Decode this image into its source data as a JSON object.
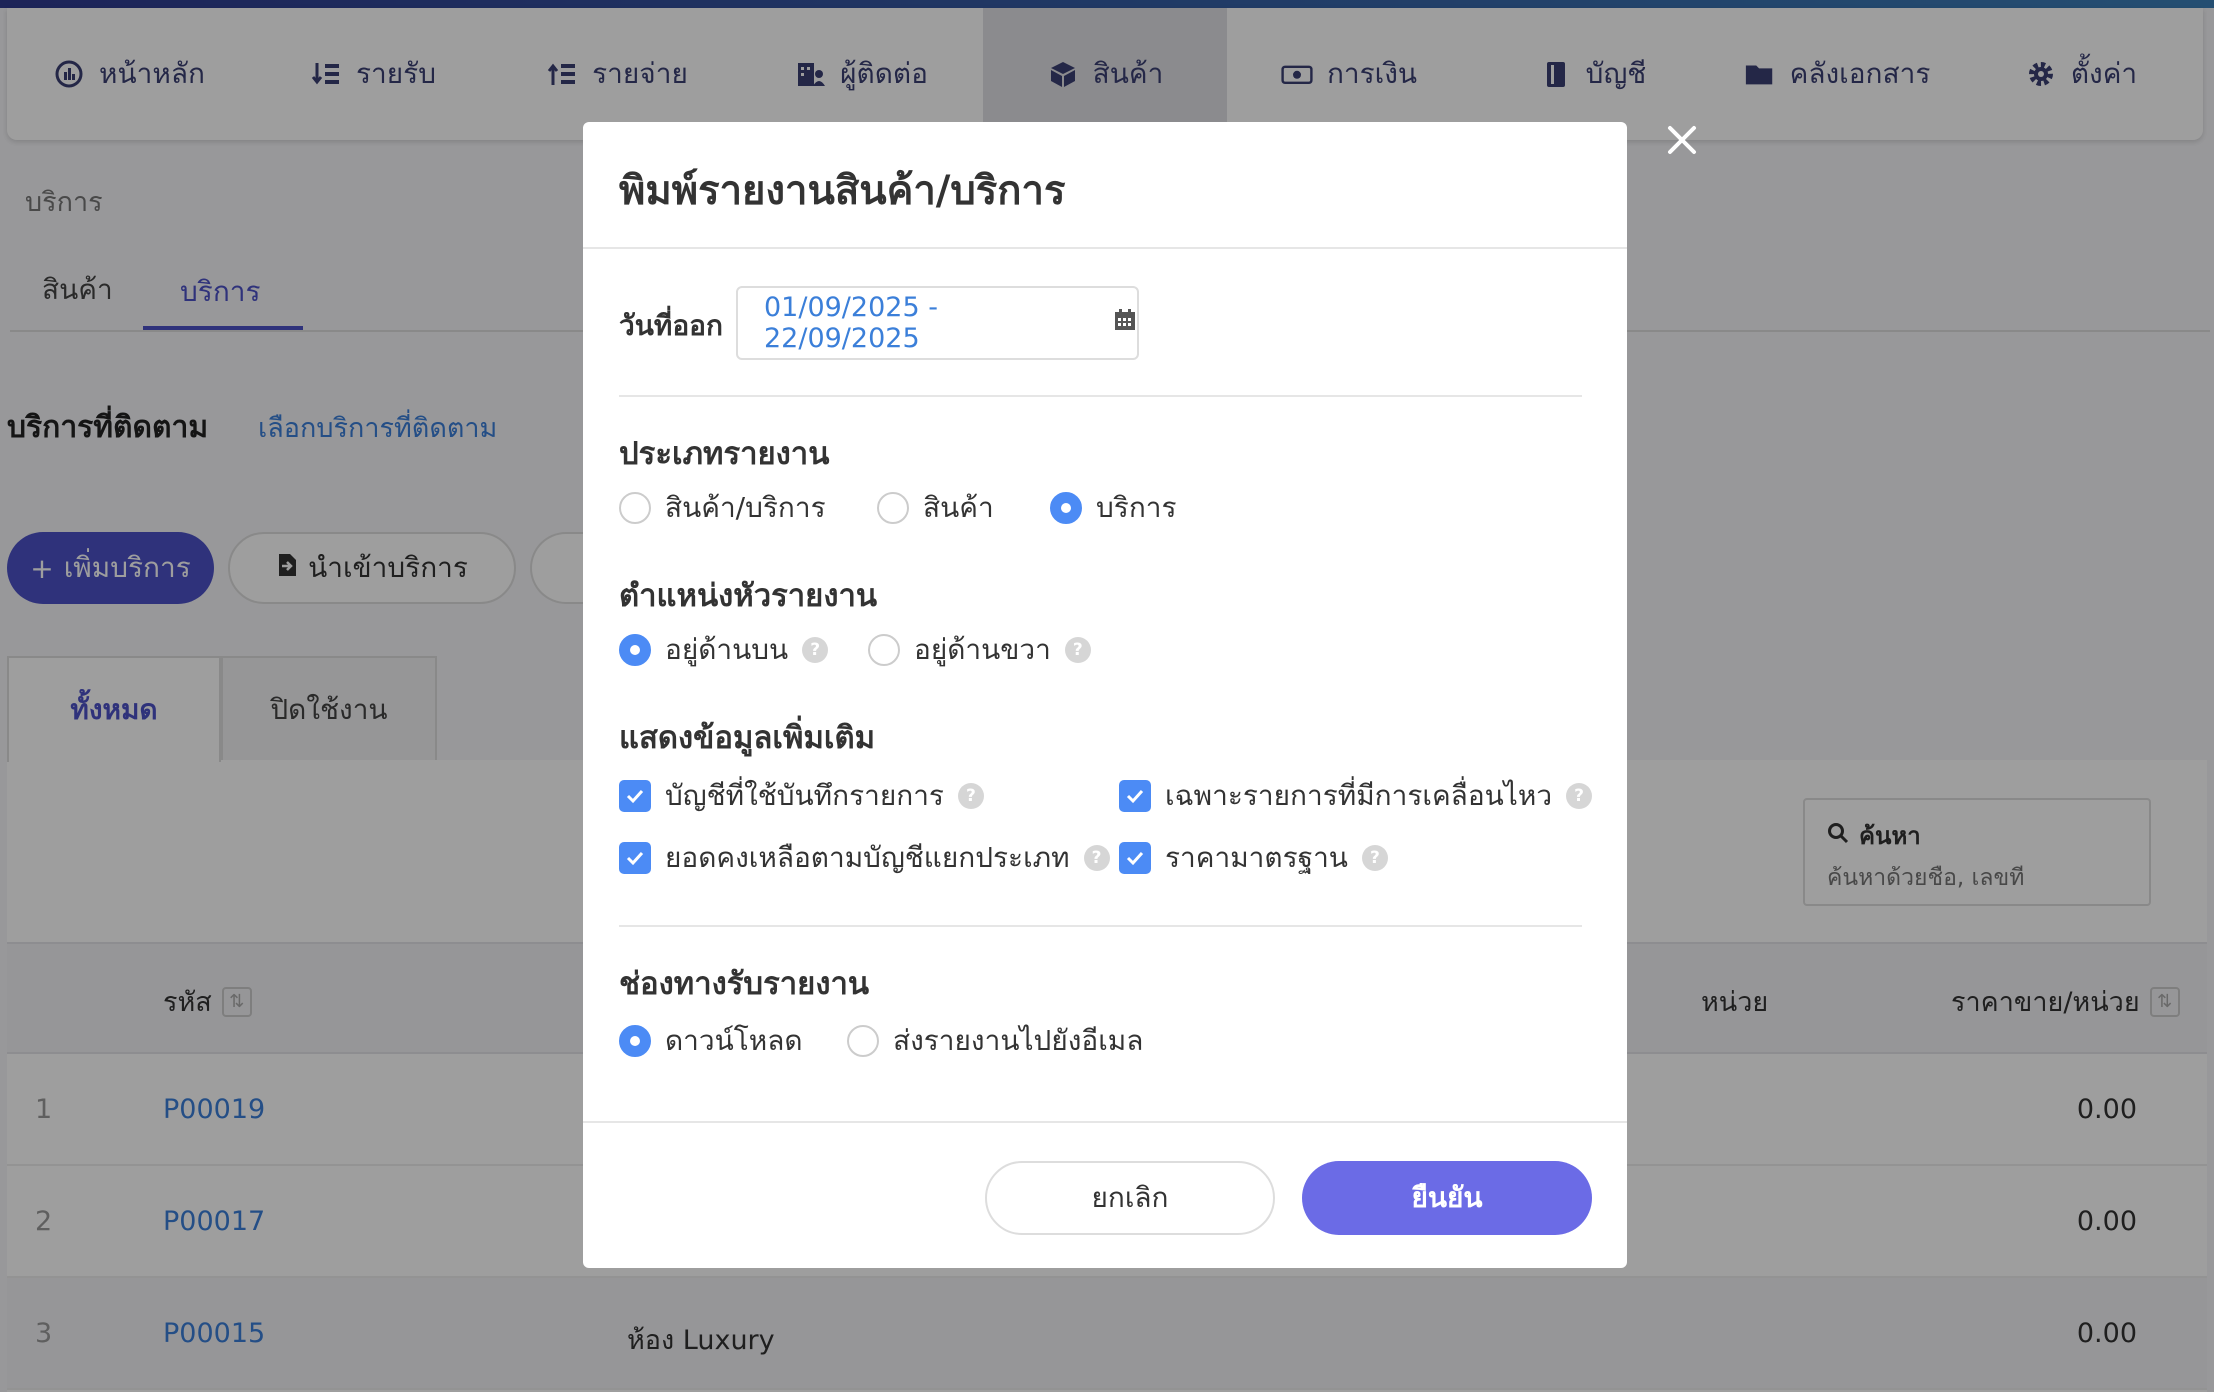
{
  "nav": {
    "items": [
      {
        "label": "หน้าหลัก",
        "icon": "dashboard-icon"
      },
      {
        "label": "รายรับ",
        "icon": "income-icon"
      },
      {
        "label": "รายจ่าย",
        "icon": "expense-icon"
      },
      {
        "label": "ผู้ติดต่อ",
        "icon": "contacts-icon"
      },
      {
        "label": "สินค้า",
        "icon": "product-box-icon"
      },
      {
        "label": "การเงิน",
        "icon": "money-icon"
      },
      {
        "label": "บัญชี",
        "icon": "ledger-book-icon"
      },
      {
        "label": "คลังเอกสาร",
        "icon": "folder-icon"
      },
      {
        "label": "ตั้งค่า",
        "icon": "gear-icon"
      }
    ],
    "active_index": 4
  },
  "page": {
    "breadcrumb": "บริการ",
    "sub_tabs": [
      "สินค้า",
      "บริการ"
    ],
    "active_sub_tab": 1,
    "tracked_title": "บริการที่ติดตาม",
    "tracked_link": "เลือกบริการที่ติดตาม",
    "add_button": "เพิ่มบริการ",
    "import_button": "นำเข้าบริการ",
    "list_tabs": [
      "ทั้งหมด",
      "ปิดใช้งาน"
    ],
    "search_label": "ค้นหา",
    "search_placeholder": "ค้นหาด้วยชื่อ, เลขที่"
  },
  "table": {
    "headers": {
      "code": "รหัส",
      "unit": "หน่วย",
      "price": "ราคาขาย/หน่วย"
    },
    "rows": [
      {
        "num": "1",
        "code": "P00019",
        "name": "",
        "price": "0.00"
      },
      {
        "num": "2",
        "code": "P00017",
        "name": "",
        "price": "0.00"
      },
      {
        "num": "3",
        "code": "P00015",
        "name": "ห้อง Luxury",
        "price": "0.00"
      }
    ]
  },
  "modal": {
    "title": "พิมพ์รายงานสินค้า/บริการ",
    "date_label": "วันที่ออก",
    "date_range": "01/09/2025 - 22/09/2025",
    "report_type": {
      "title": "ประเภทรายงาน",
      "options": [
        "สินค้า/บริการ",
        "สินค้า",
        "บริการ"
      ],
      "selected": 2
    },
    "header_position": {
      "title": "ตำแหน่งหัวรายงาน",
      "options": [
        "อยู่ด้านบน",
        "อยู่ด้านขวา"
      ],
      "selected": 0
    },
    "extra_info": {
      "title": "แสดงข้อมูลเพิ่มเติม",
      "options": [
        {
          "label": "บัญชีที่ใช้บันทึกรายการ",
          "checked": true
        },
        {
          "label": "เฉพาะรายการที่มีการเคลื่อนไหว",
          "checked": true
        },
        {
          "label": "ยอดคงเหลือตามบัญชีแยกประเภท",
          "checked": true
        },
        {
          "label": "ราคามาตรฐาน",
          "checked": true
        }
      ]
    },
    "delivery": {
      "title": "ช่องทางรับรายงาน",
      "options": [
        "ดาวน์โหลด",
        "ส่งรายงานไปยังอีเมล"
      ],
      "selected": 0
    },
    "cancel_label": "ยกเลิก",
    "confirm_label": "ยืนยัน"
  },
  "colors": {
    "primary": "#4c52c7",
    "accent_blue": "#4c8bf5",
    "confirm": "#6b6be6",
    "link": "#3b7fd9"
  }
}
